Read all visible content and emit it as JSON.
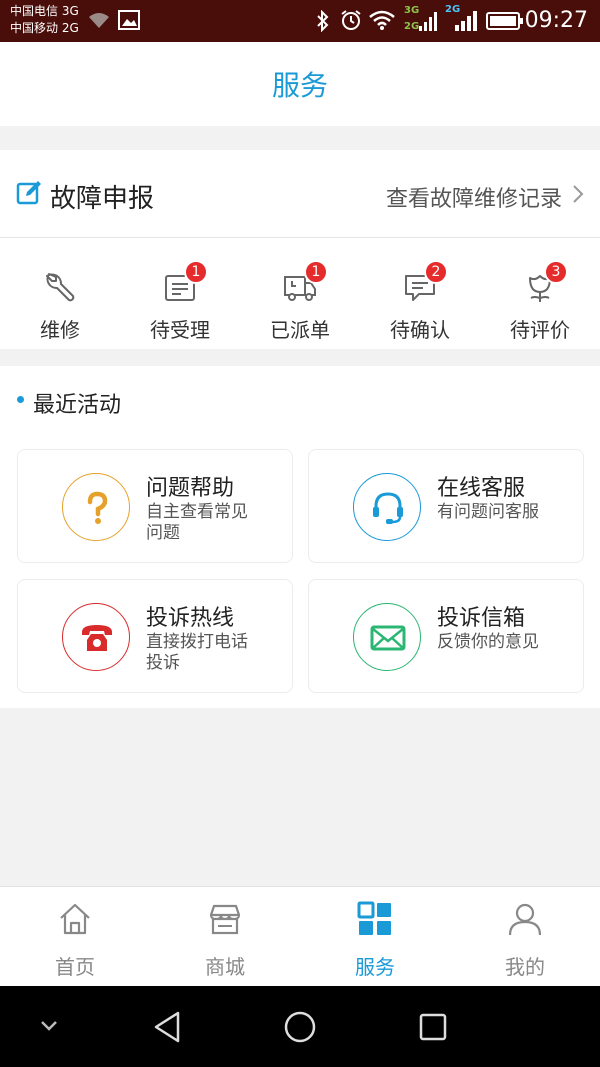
{
  "status_bar": {
    "carrier1": "中国电信 3G",
    "carrier2": "中国移动 2G",
    "net_label_top": "3G",
    "net_label_bottom": "2G",
    "net_label_right": "2G",
    "time": "09:27"
  },
  "header": {
    "title": "服务"
  },
  "fault": {
    "title": "故障申报",
    "history_link": "查看故障维修记录",
    "statuses": [
      {
        "label": "维修",
        "icon": "wrench-icon",
        "badge": ""
      },
      {
        "label": "待受理",
        "icon": "document-icon",
        "badge": "1"
      },
      {
        "label": "已派单",
        "icon": "truck-icon",
        "badge": "1"
      },
      {
        "label": "待确认",
        "icon": "message-icon",
        "badge": "2"
      },
      {
        "label": "待评价",
        "icon": "flower-icon",
        "badge": "3"
      }
    ]
  },
  "recent": {
    "title": "最近活动",
    "cards": [
      {
        "title": "问题帮助",
        "desc": "自主查看常见问题",
        "icon": "question-icon",
        "color": "#e6a12b"
      },
      {
        "title": "在线客服",
        "desc": "有问题问客服",
        "icon": "headset-icon",
        "color": "#1a9ad6"
      },
      {
        "title": "投诉热线",
        "desc": "直接拨打电话投诉",
        "icon": "phone-icon",
        "color": "#d92b2b"
      },
      {
        "title": "投诉信箱",
        "desc": "反馈你的意见",
        "icon": "mail-icon",
        "color": "#2bb673"
      }
    ]
  },
  "tabs": [
    {
      "label": "首页",
      "icon": "home-icon",
      "active": false
    },
    {
      "label": "商城",
      "icon": "store-icon",
      "active": false
    },
    {
      "label": "服务",
      "icon": "grid-icon",
      "active": true
    },
    {
      "label": "我的",
      "icon": "user-icon",
      "active": false
    }
  ],
  "colors": {
    "accent": "#1a9ad6",
    "badge": "#e52b2b",
    "status_bar": "#4a0e0a"
  }
}
